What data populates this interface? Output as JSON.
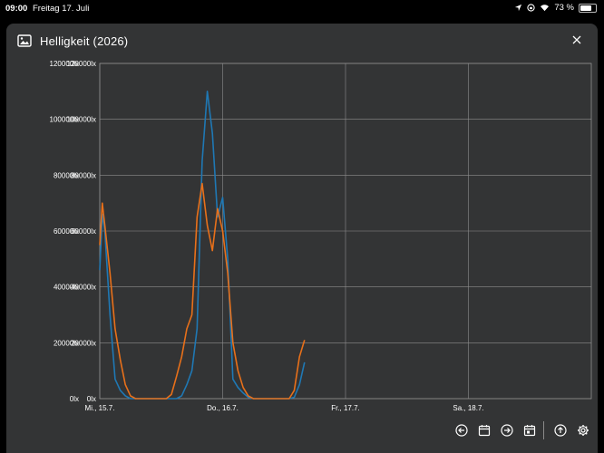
{
  "status": {
    "time": "09:00",
    "date": "Freitag 17. Juli",
    "battery": "73 %",
    "battery_level": 0.73
  },
  "dialog": {
    "title": "Helligkeit  (2026)",
    "icons": [
      "image-icon",
      "close-icon"
    ]
  },
  "toolbar": {
    "buttons": [
      "previous-icon",
      "calendar-icon",
      "next-icon",
      "calendar-today-icon",
      "upload-icon",
      "gear-icon"
    ]
  },
  "colors": {
    "background": "#333435",
    "grid": "#8e8e8e",
    "text": "#ffffff",
    "series_blue": "#1f78b4",
    "series_orange": "#e8701a"
  },
  "chart_data": {
    "type": "line",
    "title": "",
    "xlabel": "",
    "ylabel": "",
    "ylim": [
      0,
      120000
    ],
    "yticks": [
      {
        "value": 0,
        "label": "0lx"
      },
      {
        "value": 20000,
        "label": "20000lx"
      },
      {
        "value": 40000,
        "label": "40000lx"
      },
      {
        "value": 60000,
        "label": "60000lx"
      },
      {
        "value": 80000,
        "label": "80000lx"
      },
      {
        "value": 100000,
        "label": "100000lx"
      },
      {
        "value": 120000,
        "label": "120000lx"
      }
    ],
    "xlim": [
      0,
      96
    ],
    "xticks": [
      {
        "value": 0,
        "label": "Mi., 15.7."
      },
      {
        "value": 24,
        "label": "Do., 16.7."
      },
      {
        "value": 48,
        "label": "Fr., 17.7."
      },
      {
        "value": 72,
        "label": "Sa., 18.7."
      }
    ],
    "x_unit": "hours since 15.7. 00:00",
    "grid": true,
    "legend": "none",
    "series": [
      {
        "color": "#1f78b4",
        "x": [
          0,
          0.5,
          1,
          2,
          3,
          4,
          5,
          6,
          7,
          12,
          13,
          14,
          15,
          16,
          17,
          18,
          19,
          20,
          21,
          22,
          23,
          24,
          25,
          26,
          27,
          28,
          29,
          30,
          36,
          37,
          38,
          39,
          40
        ],
        "y": [
          46000,
          66000,
          60000,
          30000,
          7000,
          3000,
          1000,
          0,
          0,
          0,
          0,
          0,
          0,
          1000,
          5000,
          10000,
          25000,
          85000,
          110000,
          95000,
          65000,
          72000,
          50000,
          7000,
          4000,
          2000,
          500,
          0,
          0,
          0,
          500,
          5000,
          13000
        ]
      },
      {
        "color": "#e8701a",
        "x": [
          0,
          0.5,
          1,
          2,
          3,
          4,
          5,
          6,
          7,
          12,
          13,
          14,
          15,
          16,
          17,
          18,
          19,
          20,
          21,
          22,
          23,
          24,
          25,
          26,
          27,
          28,
          29,
          30,
          36,
          37,
          38,
          39,
          40
        ],
        "y": [
          55000,
          70000,
          62000,
          45000,
          25000,
          14000,
          5000,
          1000,
          0,
          0,
          0,
          1500,
          8000,
          15000,
          25000,
          30000,
          65000,
          77000,
          62000,
          53000,
          68000,
          60000,
          45000,
          20000,
          10000,
          4000,
          1000,
          0,
          0,
          0,
          3000,
          15000,
          21000
        ]
      }
    ]
  }
}
